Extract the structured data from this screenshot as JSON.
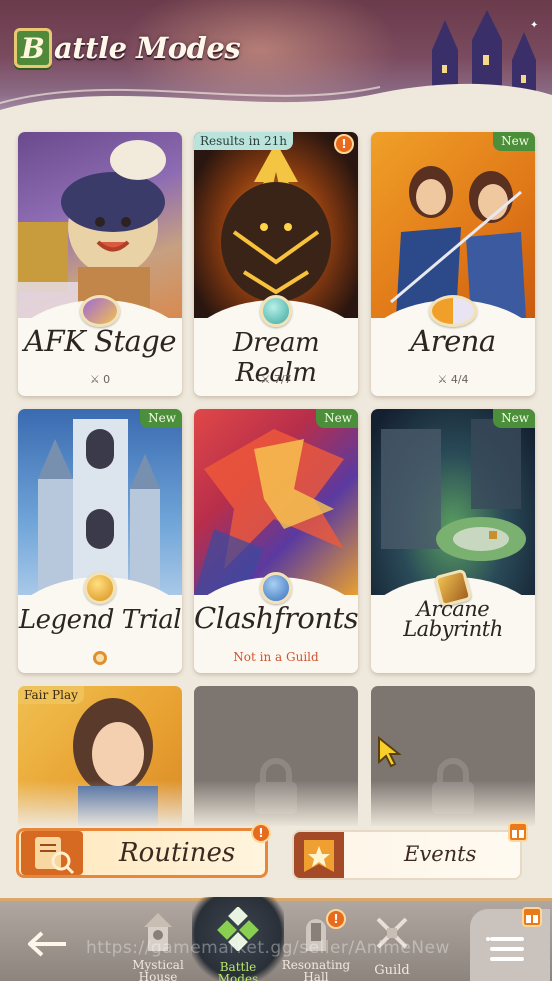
{
  "header": {
    "badge_letter": "B",
    "title": "attle Modes"
  },
  "cards": [
    {
      "id": "afk-stage",
      "name": "AFK Stage",
      "sub": "⚔ 0"
    },
    {
      "id": "dream-realm",
      "name": "Dream Realm",
      "sub": "⚔ 7/7",
      "badge": "Results in 21h",
      "alert": "!"
    },
    {
      "id": "arena",
      "name": "Arena",
      "sub": "⚔ 4/4",
      "badge": "New"
    },
    {
      "id": "legend-trial",
      "name": "Legend Trial",
      "badge": "New"
    },
    {
      "id": "clashfronts",
      "name": "Clashfronts",
      "sub": "Not in a Guild",
      "badge": "New"
    },
    {
      "id": "arcane-labyrinth",
      "name_line1": "Arcane",
      "name_line2": "Labyrinth",
      "badge": "New"
    },
    {
      "id": "fair-play",
      "badge": "Fair Play"
    }
  ],
  "banners": {
    "routines": {
      "label": "Routines",
      "alert": "!"
    },
    "events": {
      "label": "Events"
    }
  },
  "nav": {
    "items": [
      {
        "line1": "Mystical",
        "line2": "House"
      },
      {
        "line1": "Battle Modes"
      },
      {
        "line1": "Resonating",
        "line2": "Hall",
        "alert": "!"
      },
      {
        "line1": "Guild"
      }
    ]
  },
  "watermark": "https://gamemarket.gg/seller/AnimeNew",
  "colors": {
    "accent_green": "#4b8f3a",
    "alert_orange": "#e86a1c",
    "nav_active": "#b8e86a",
    "routines_border": "#e8863a"
  }
}
